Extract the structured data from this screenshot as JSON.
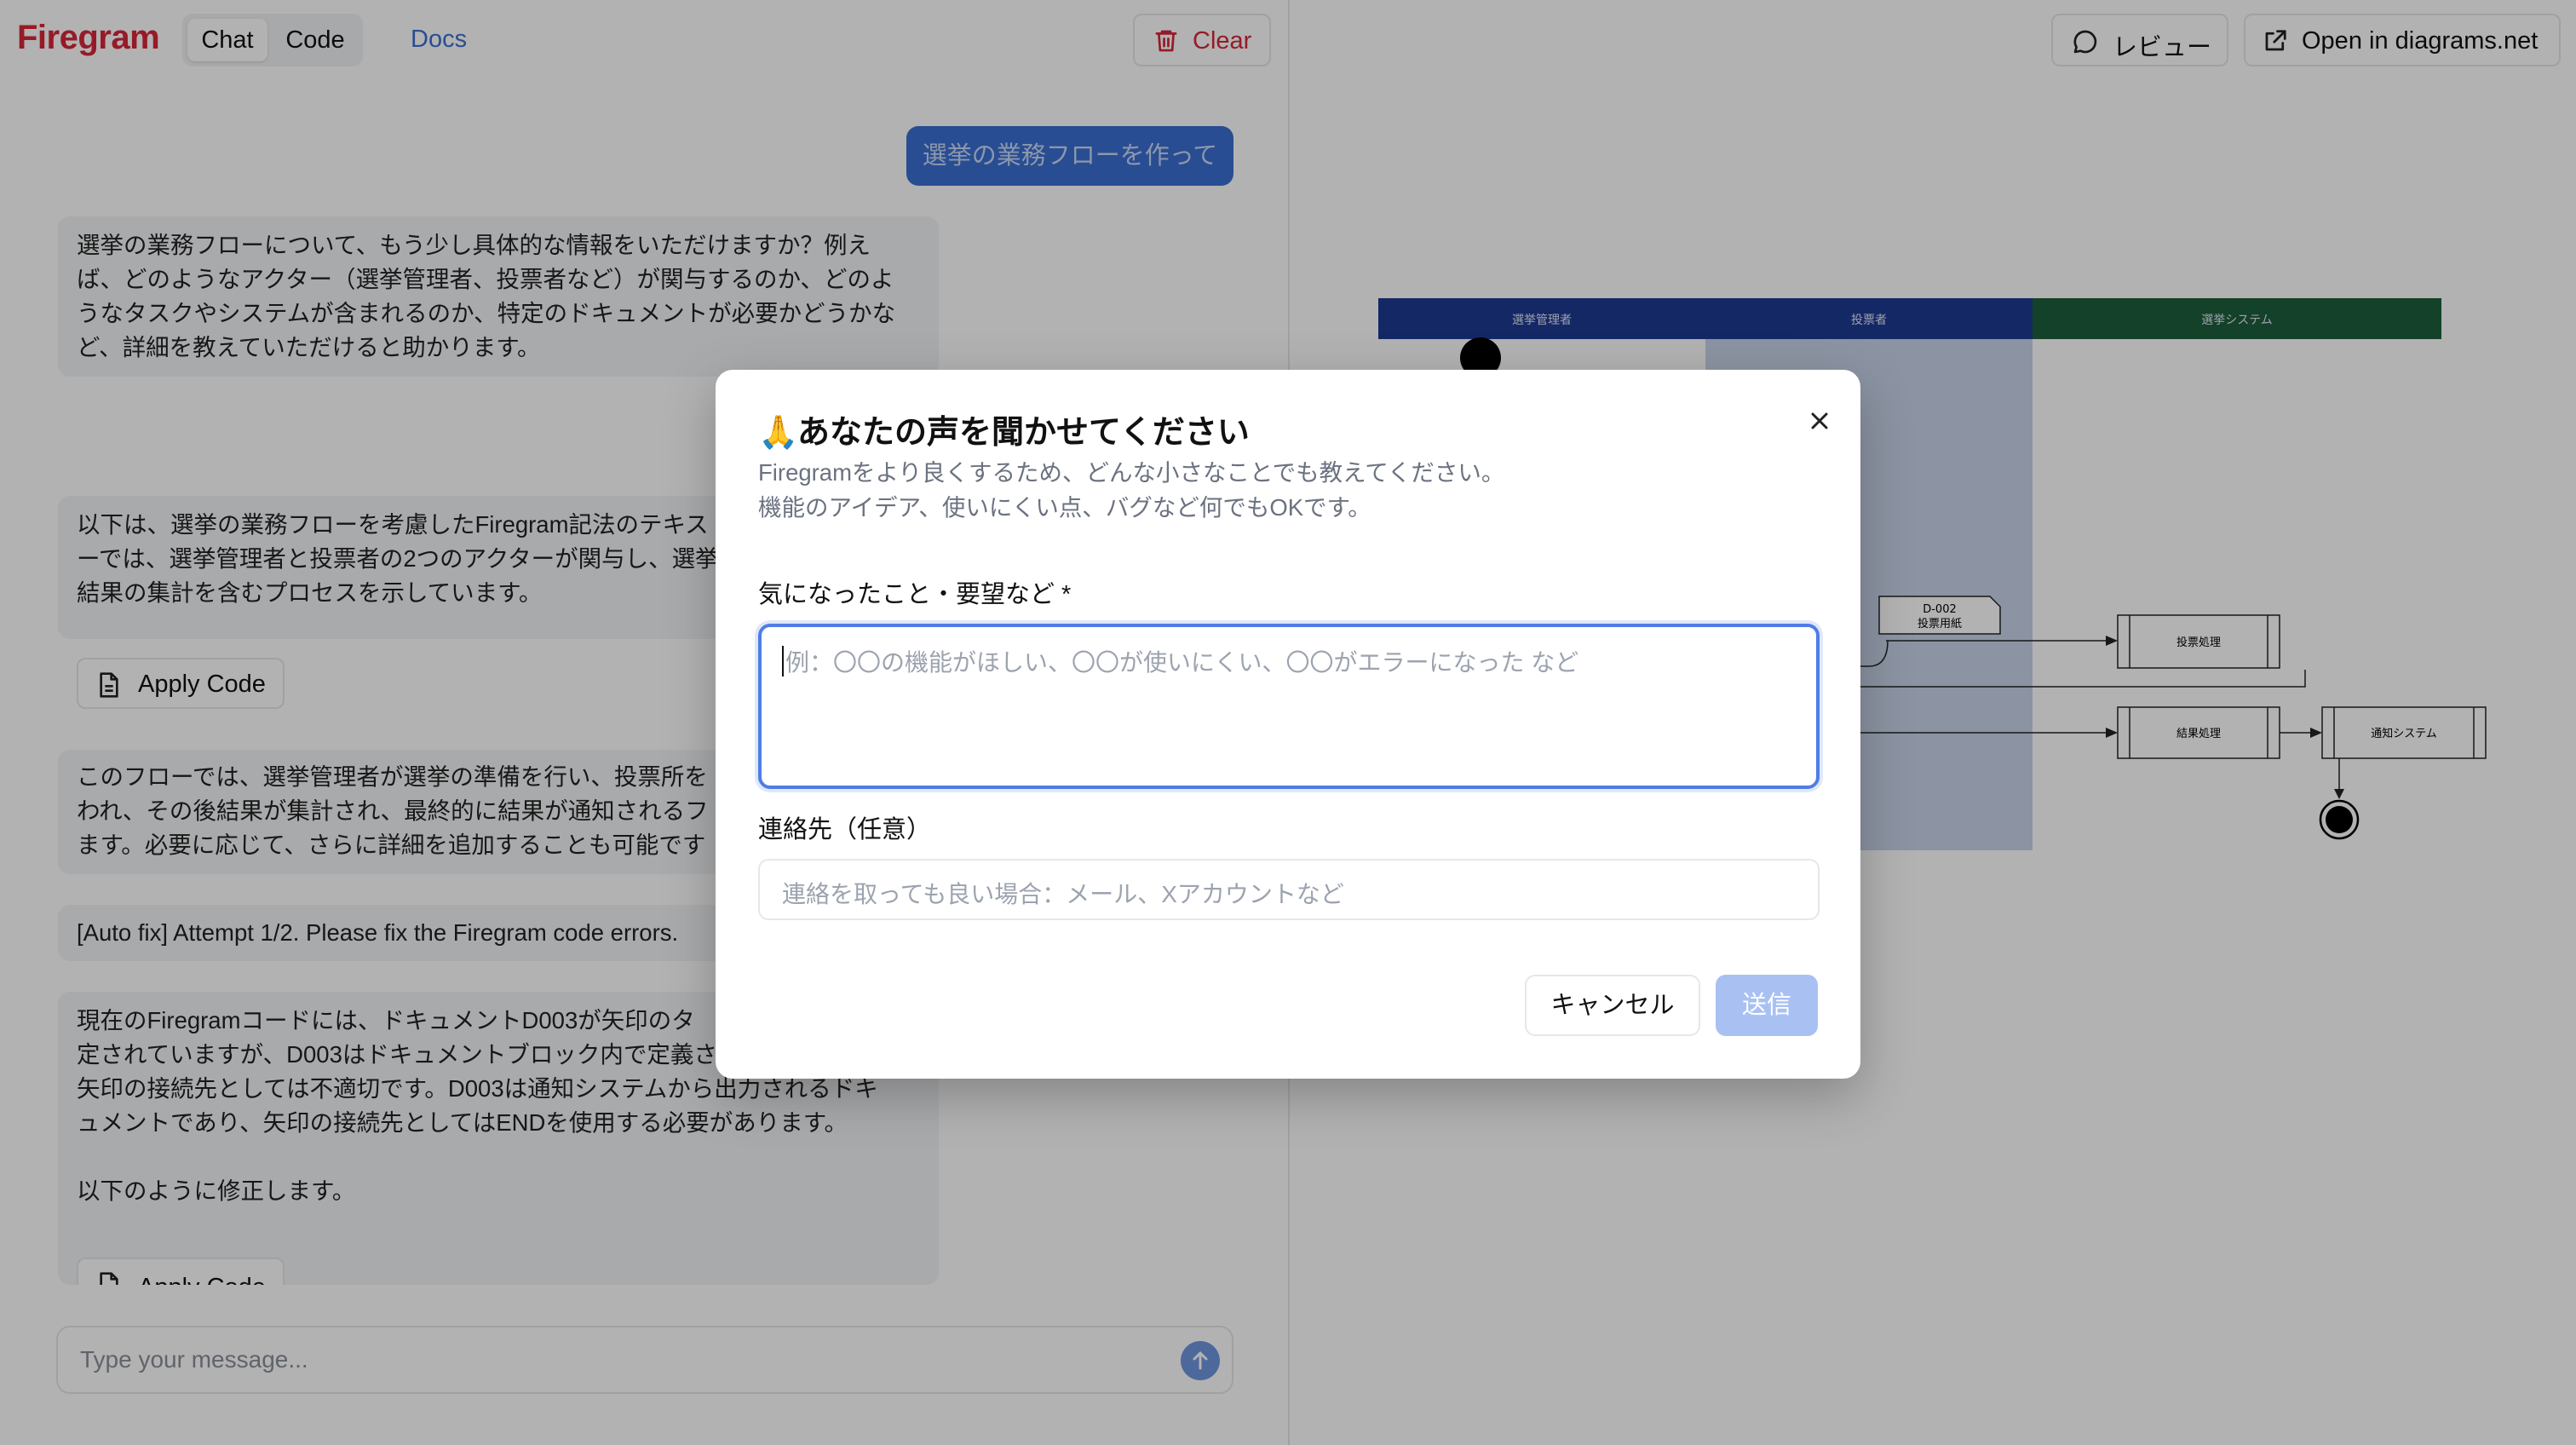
{
  "header": {
    "logo": "Firegram",
    "mode_tabs": [
      {
        "label": "Chat"
      },
      {
        "label": "Code"
      }
    ],
    "docs_label": "Docs",
    "clear_label": "Clear",
    "review_label": "レビュー",
    "open_label": "Open in diagrams.net"
  },
  "chat": {
    "user_message": "選挙の業務フローを作って",
    "messages": [
      "選挙の業務フローについて、もう少し具体的な情報をいただけますか？例え\nば、どのようなアクター（選挙管理者、投票者など）が関与するのか、どのよ\nうなタスクやシステムが含まれるのか、特定のドキュメントが必要かどうかな\nど、詳細を教えていただけると助かります。",
      "以下は、選挙の業務フローを考慮したFiregram記法のテキス\nーでは、選挙管理者と投票者の2つのアクターが関与し、選挙\n結果の集計を含むプロセスを示しています。",
      "このフローでは、選挙管理者が選挙の準備を行い、投票所を\nわれ、その後結果が集計され、最終的に結果が通知されるフ\nます。必要に応じて、さらに詳細を追加することも可能です",
      "[Auto fix] Attempt 1/2. Please fix the Firegram code errors.",
      "現在のFiregramコードには、ドキュメントD003が矢印のタ\n定されていますが、D003はドキュメントブロック内で定義さ\n矢印の接続先としては不適切です。D003は通知システムから出力されるドキ\nュメントであり、矢印の接続先としてはENDを使用する必要があります。\n\n以下のように修正します。"
    ],
    "apply_code_label": "Apply Code",
    "input_placeholder": "Type your message..."
  },
  "diagram": {
    "lanes": [
      "選挙管理者",
      "投票者",
      "選挙システム"
    ],
    "lane_colors": [
      "#1f3a93",
      "#1f3a93",
      "#1e5e3b"
    ],
    "document": {
      "id": "D-002",
      "name": "投票用紙"
    },
    "processes": [
      "投票処理",
      "結果処理",
      "通知システム"
    ]
  },
  "modal": {
    "emoji": "🙏",
    "title": "あなたの声を聞かせてください",
    "desc_line1": "Firegramをより良くするため、どんな小さなことでも教えてください。",
    "desc_line2": "機能のアイデア、使いにくい点、バグなど何でもOKです。",
    "feedback_label": "気になったこと・要望など *",
    "feedback_placeholder": "例：〇〇の機能がほしい、〇〇が使いにくい、〇〇がエラーになった など",
    "contact_label": "連絡先（任意）",
    "contact_placeholder": "連絡を取っても良い場合：メール、Xアカウントなど",
    "cancel_label": "キャンセル",
    "submit_label": "送信"
  }
}
